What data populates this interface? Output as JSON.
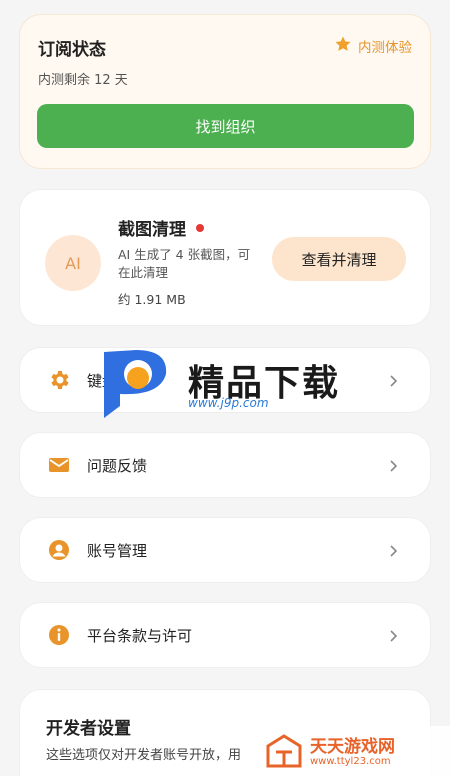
{
  "subscription": {
    "title": "订阅状态",
    "badge_label": "内测体验",
    "remaining": "内测剩余 12 天",
    "button_label": "找到组织",
    "accent": "#4caf50",
    "badge_color": "#e8942a"
  },
  "clean": {
    "avatar_text": "AI",
    "title": "截图清理",
    "description": "AI 生成了 4 张截图，可在此清理",
    "size": "约 1.91 MB",
    "button_label": "查看并清理"
  },
  "rows": [
    {
      "label": "键盘设置",
      "icon": "gear-icon"
    },
    {
      "label": "问题反馈",
      "icon": "mail-icon"
    },
    {
      "label": "账号管理",
      "icon": "account-icon"
    },
    {
      "label": "平台条款与许可",
      "icon": "info-icon"
    }
  ],
  "developer": {
    "title": "开发者设置",
    "description": "这些选项仅对开发者账号开放，用"
  },
  "watermark": {
    "main_text": "精品下载",
    "main_url": "www.j9p.com",
    "corner_text": "天天游戏网",
    "corner_url": "www.ttyl23.com"
  },
  "icon_color": "#e8942a"
}
